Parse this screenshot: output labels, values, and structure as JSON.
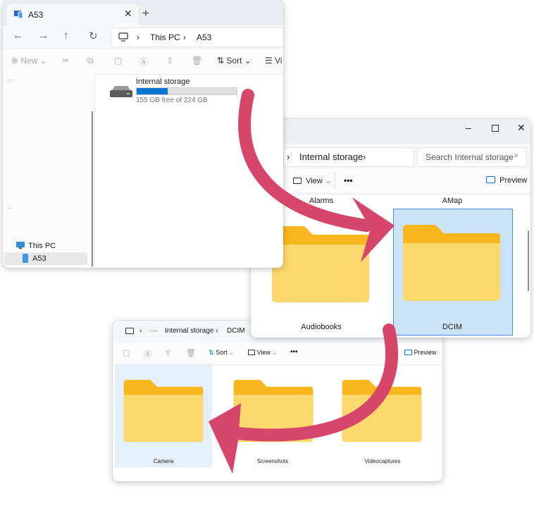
{
  "window1": {
    "tab_title": "A53",
    "address": {
      "this_pc": "This PC",
      "device": "A53"
    },
    "toolbar": {
      "new": "New",
      "sort": "Sort",
      "view": "Vi"
    },
    "sidebar": {
      "this_pc": "This PC",
      "a53": "A53",
      "collapsed_1": "...",
      "collapsed_2": "..."
    },
    "drive": {
      "name": "Internal storage",
      "free_text": "155 GB free of 224 GB",
      "used_fraction": 0.31,
      "bar_color": "#0a74d0"
    }
  },
  "window2": {
    "breadcrumb": "Internal storage",
    "search_placeholder": "Search Internal storage",
    "toolbar": {
      "view": "View",
      "more": "•••",
      "preview": "Preview"
    },
    "folders": [
      {
        "name": "Alarms"
      },
      {
        "name": "AMap"
      },
      {
        "name": "Audiobooks"
      },
      {
        "name": "DCIM",
        "selected": true
      }
    ]
  },
  "window3": {
    "breadcrumb": {
      "ellipsis": "···",
      "storage": "Internal storage",
      "folder": "DCIM"
    },
    "toolbar": {
      "sort": "Sort",
      "view": "View",
      "more": "•••",
      "preview": "Preview"
    },
    "folders": [
      {
        "name": "Camera",
        "selected": true
      },
      {
        "name": "Screenshots"
      },
      {
        "name": "Videocaptures"
      }
    ]
  },
  "colors": {
    "arrow": "#d6456a",
    "selection": "#cce4f7",
    "folder_back": "#f7b71d",
    "folder_front": "#fcd86d",
    "accent": "#0a74d0"
  }
}
